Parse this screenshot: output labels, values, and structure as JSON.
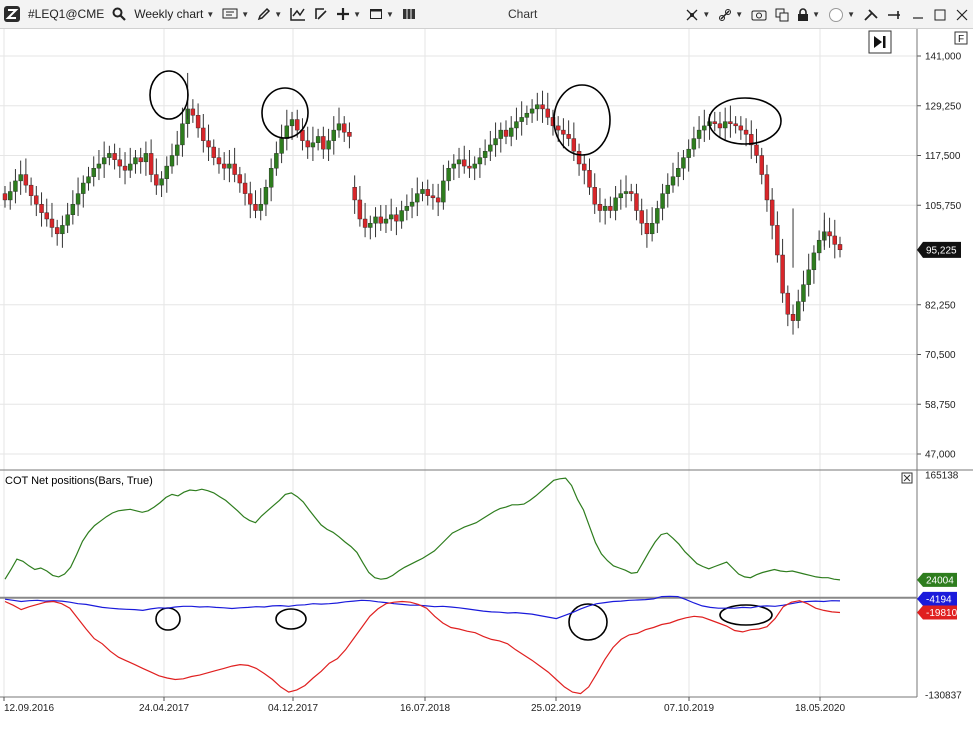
{
  "toolbar": {
    "symbol": "#LEQ1@CME",
    "timeframe": "Weekly chart",
    "title": "Chart"
  },
  "icons": [
    "app-logo-icon",
    "search-icon",
    "bars-icon",
    "pencil-icon",
    "indicator-icon",
    "template-icon",
    "crosshair-icon",
    "window-icon",
    "layout-icon",
    "magnet-icon",
    "link-icon",
    "camera-icon",
    "copy-icon",
    "lock-icon",
    "circle-icon",
    "tools-icon",
    "pin-icon",
    "minimize-icon",
    "maximize-icon",
    "close-icon"
  ],
  "colors": {
    "up": "#2e7d1e",
    "down": "#d8262a",
    "green_line": "#2e7d1e",
    "blue_line": "#1a1adb",
    "red_line": "#e02020",
    "price_badge": "#111111",
    "grid": "#e6e6e6"
  },
  "chart_data": [
    {
      "type": "candlestick",
      "title": "",
      "yaxis_ticks": [
        "141,000",
        "129,250",
        "117,500",
        "105,750",
        "95,225",
        "82,250",
        "70,500",
        "58,750",
        "47,000"
      ],
      "ylim": [
        47000,
        141000
      ],
      "last_price": "95,225",
      "xaxis_ticks": [
        "12.09.2016",
        "24.04.2017",
        "04.12.2017",
        "16.07.2018",
        "25.02.2019",
        "07.10.2019",
        "18.05.2020"
      ],
      "series_close": [
        107000,
        109000,
        111500,
        113000,
        110500,
        108000,
        106000,
        104000,
        102500,
        100500,
        99000,
        101000,
        103500,
        106000,
        108500,
        111000,
        112500,
        114500,
        115500,
        117000,
        118000,
        116500,
        115000,
        114000,
        115500,
        117000,
        116000,
        118000,
        113000,
        110500,
        112000,
        115000,
        117500,
        120000,
        125000,
        128500,
        127000,
        124000,
        121000,
        119500,
        117000,
        115500,
        114500,
        115500,
        113000,
        111000,
        108500,
        106000,
        104500,
        106000,
        110000,
        114500,
        118000,
        121500,
        124500,
        126000,
        123500,
        121000,
        119500,
        120500,
        122000,
        119000,
        121000,
        123500,
        125000,
        123000,
        122000,
        107000,
        102500,
        100500,
        101500,
        103000,
        101500,
        102500,
        103500,
        102000,
        104500,
        105500,
        106500,
        108500,
        109500,
        108000,
        107500,
        106500,
        111500,
        114500,
        115500,
        116500,
        115000,
        114500,
        115500,
        117000,
        118500,
        120000,
        121500,
        123500,
        122000,
        124000,
        125500,
        126500,
        127500,
        128500,
        129500,
        128500,
        126500,
        124500,
        123500,
        122500,
        121500,
        118500,
        115500,
        114000,
        110000,
        106000,
        104500,
        105500,
        104500,
        107500,
        108500,
        109000,
        108500,
        104500,
        101500,
        99000,
        101500,
        105000,
        108500,
        110500,
        112500,
        114500,
        117000,
        119000,
        121500,
        123500,
        124500,
        125500,
        125000,
        124000,
        125500,
        125000,
        124500,
        123500,
        122500,
        120000,
        117500,
        113000,
        107000,
        101000,
        94000,
        85000,
        80000,
        78500,
        83000,
        87000,
        90500,
        94500,
        97500,
        99500,
        98500,
        96500,
        95225
      ],
      "series_low_annotations": [
        "circle-2017-04",
        "circle-2017-12",
        "circle-2019-03",
        "circle-2019-12"
      ]
    },
    {
      "type": "line",
      "title": "COT Net positions(Bars, True)",
      "yaxis_ticks": [
        "165138",
        "-130837"
      ],
      "ylim": [
        -130837,
        165138
      ],
      "series": [
        {
          "name": "",
          "color": "green",
          "last_value": "24004",
          "values": [
            25000,
            38000,
            52000,
            49000,
            43000,
            38000,
            40000,
            36000,
            30000,
            28000,
            32000,
            41000,
            58000,
            76000,
            88000,
            97000,
            103000,
            109000,
            114000,
            117000,
            118000,
            119000,
            117000,
            115000,
            117000,
            122000,
            128000,
            135000,
            139000,
            137000,
            142000,
            145000,
            144000,
            146000,
            144000,
            141000,
            136000,
            131000,
            124000,
            117000,
            109000,
            104000,
            101000,
            110000,
            117000,
            124000,
            131000,
            139000,
            141000,
            136000,
            129000,
            118000,
            108000,
            98000,
            92000,
            88000,
            82000,
            75000,
            69000,
            61000,
            47000,
            34000,
            27000,
            25000,
            26000,
            30000,
            36000,
            41000,
            45000,
            49000,
            53000,
            58000,
            63000,
            71000,
            79000,
            87000,
            91000,
            95000,
            98000,
            101000,
            106000,
            111000,
            116000,
            120000,
            122000,
            125000,
            125000,
            126000,
            131000,
            137000,
            144000,
            151000,
            158000,
            160000,
            161000,
            151000,
            132000,
            118000,
            96000,
            74000,
            59000,
            50000,
            43000,
            40000,
            37000,
            33000,
            34000,
            48000,
            62000,
            75000,
            85000,
            87000,
            80000,
            72000,
            62000,
            54000,
            46000,
            42000,
            39000,
            42000,
            45000,
            48000,
            40000,
            32000,
            28000,
            27000,
            31000,
            34000,
            36000,
            38000,
            36000,
            35000,
            36000,
            34000,
            32000,
            30000,
            28000,
            27000,
            27000,
            25000,
            24004
          ]
        },
        {
          "name": "",
          "color": "blue",
          "last_value": "-4194",
          "values": [
            -2000,
            -3500,
            -5000,
            -4000,
            -3500,
            -4500,
            -4000,
            -4500,
            -6000,
            -8000,
            -9000,
            -11000,
            -13000,
            -14000,
            -15000,
            -15500,
            -16000,
            -17000,
            -15000,
            -13500,
            -14000,
            -12500,
            -11500,
            -11500,
            -12500,
            -12000,
            -13000,
            -13500,
            -14500,
            -13500,
            -13000,
            -12000,
            -12500,
            -11000,
            -10500,
            -11500,
            -10000,
            -9500,
            -8000,
            -8500,
            -8000,
            -7000,
            -5500,
            -4500,
            -3500,
            -4000,
            -5500,
            -6500,
            -8000,
            -9000,
            -10000,
            -10000,
            -11000,
            -12000,
            -11500,
            -12500,
            -13500,
            -15000,
            -16500,
            -18000,
            -19000,
            -19500,
            -20500,
            -20000,
            -21000,
            -22000,
            -24000,
            -26000,
            -28000,
            -24000,
            -20000,
            -15000,
            -11000,
            -8000,
            -6500,
            -5000,
            -4500,
            -3500,
            -3000,
            -2500,
            -1500,
            1500,
            2000,
            1500,
            -2500,
            -7000,
            -11000,
            -13000,
            -14000,
            -14000,
            -14000,
            -13000,
            -13500,
            -11500,
            -11000,
            -11500,
            -10000,
            -8000,
            -6000,
            -5000,
            -4500,
            -5000,
            -4000,
            -4194
          ]
        },
        {
          "name": "",
          "color": "red",
          "last_value": "-19810",
          "values": [
            -5000,
            -10000,
            -16000,
            -12000,
            -9000,
            -6000,
            -5000,
            -8000,
            -14000,
            -28000,
            -42000,
            -55000,
            -62000,
            -72000,
            -80000,
            -85000,
            -90000,
            -95000,
            -100000,
            -105000,
            -108000,
            -110000,
            -109000,
            -106000,
            -104000,
            -101000,
            -98000,
            -95000,
            -92000,
            -90000,
            -91000,
            -95000,
            -102000,
            -110000,
            -120000,
            -127000,
            -124000,
            -118000,
            -108000,
            -99000,
            -88000,
            -82000,
            -70000,
            -55000,
            -40000,
            -25000,
            -15000,
            -8000,
            -6000,
            -5000,
            -6000,
            -9000,
            -14000,
            -25000,
            -34000,
            -40000,
            -42000,
            -45000,
            -47000,
            -52000,
            -56000,
            -58000,
            -62000,
            -70000,
            -77000,
            -84000,
            -92000,
            -100000,
            -110000,
            -120000,
            -127000,
            -129000,
            -120000,
            -102000,
            -83000,
            -67000,
            -56000,
            -50000,
            -48000,
            -43000,
            -40000,
            -36000,
            -34000,
            -30000,
            -27000,
            -25000,
            -26000,
            -30000,
            -34000,
            -38000,
            -44000,
            -46000,
            -43000,
            -42000,
            -39000,
            -28000,
            -12000,
            -6000,
            -4000,
            -8000,
            -14000,
            -17000,
            -19000,
            -19810
          ]
        }
      ]
    }
  ]
}
